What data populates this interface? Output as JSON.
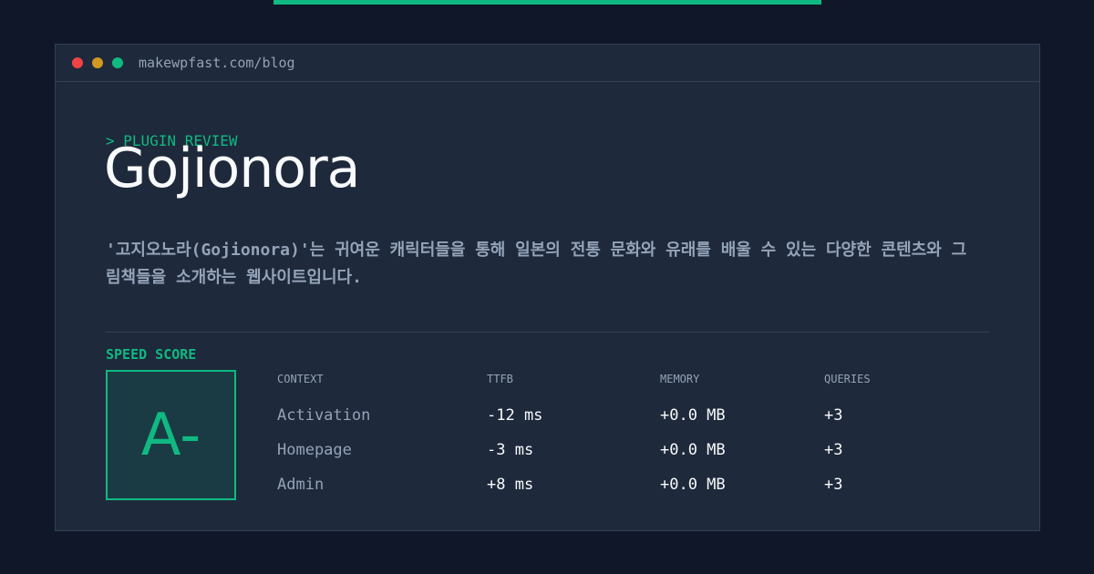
{
  "window": {
    "url": "makewpfast.com/blog",
    "dots": {
      "red": "#ef4444",
      "yellow": "#eab308",
      "green": "#10b981"
    }
  },
  "post": {
    "eyebrow": "> PLUGIN REVIEW",
    "title": "Gojionora",
    "description": "'고지오노라(Gojionora)'는 귀여운 캐릭터들을 통해 일본의 전통 문화와 유래를 배울 수 있는 다양한 콘텐츠와 그림책들을 소개하는 웹사이트입니다."
  },
  "speed": {
    "label": "SPEED SCORE",
    "grade": "A-",
    "columns": [
      "CONTEXT",
      "TTFB",
      "MEMORY",
      "QUERIES"
    ],
    "rows": [
      {
        "context": "Activation",
        "ttfb": "-12 ms",
        "memory": "+0.0 MB",
        "queries": "+3"
      },
      {
        "context": "Homepage",
        "ttfb": "-3 ms",
        "memory": "+0.0 MB",
        "queries": "+3"
      },
      {
        "context": "Admin",
        "ttfb": "+8 ms",
        "memory": "+0.0 MB",
        "queries": "+3"
      }
    ]
  },
  "colors": {
    "accent": "#10b981",
    "background": "#0f1729",
    "panel": "#1e293b"
  }
}
